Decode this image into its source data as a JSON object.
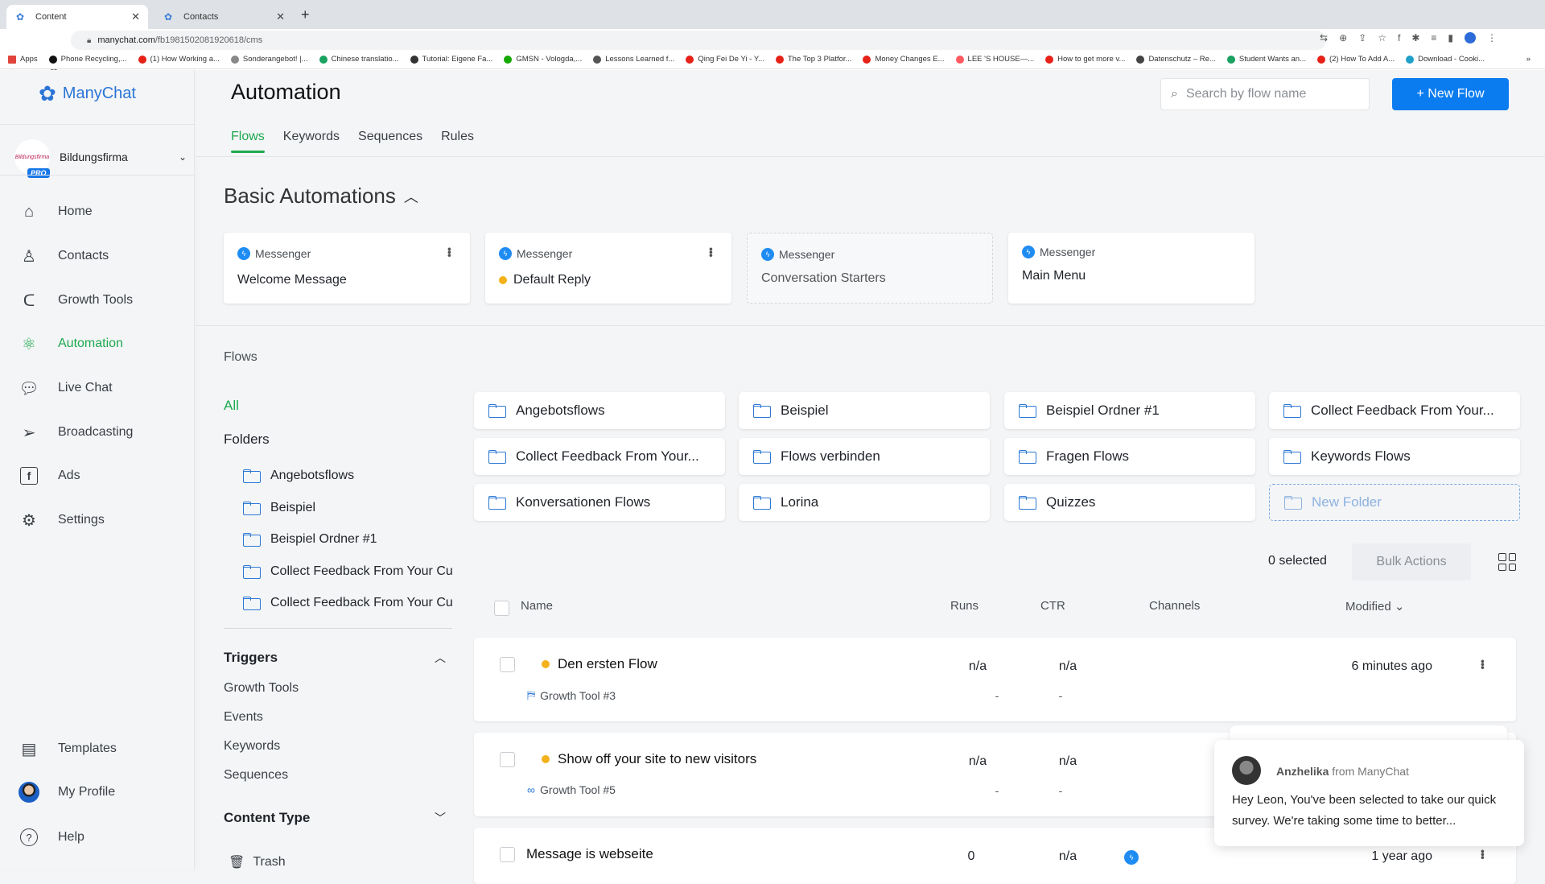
{
  "browser": {
    "tabs": [
      {
        "label": "Content",
        "active": true
      },
      {
        "label": "Contacts",
        "active": false
      }
    ],
    "new_tab": "+",
    "url_host": "manychat.com",
    "url_path": "/fb1981502081920618/cms",
    "bookmarks": [
      {
        "label": "Apps",
        "color": "#e0443a"
      },
      {
        "label": "Phone Recycling,...",
        "color": "#111111"
      },
      {
        "label": "(1) How Working a...",
        "color": "#e62117"
      },
      {
        "label": "Sonderangebot! |...",
        "color": "#888888"
      },
      {
        "label": "Chinese translatio...",
        "color": "#1aa260"
      },
      {
        "label": "Tutorial: Eigene Fa...",
        "color": "#333333"
      },
      {
        "label": "GMSN - Vologda,...",
        "color": "#14a800"
      },
      {
        "label": "Lessons Learned f...",
        "color": "#555555"
      },
      {
        "label": "Qing Fei De Yi - Y...",
        "color": "#e62117"
      },
      {
        "label": "The Top 3 Platfor...",
        "color": "#e62117"
      },
      {
        "label": "Money Changes E...",
        "color": "#e62117"
      },
      {
        "label": "LEE 'S HOUSE—...",
        "color": "#ff5a5f"
      },
      {
        "label": "How to get more v...",
        "color": "#e62117"
      },
      {
        "label": "Datenschutz – Re...",
        "color": "#444444"
      },
      {
        "label": "Student Wants an...",
        "color": "#1aa260"
      },
      {
        "label": "(2) How To Add A...",
        "color": "#e62117"
      },
      {
        "label": "Download - Cooki...",
        "color": "#1fa0c8"
      }
    ],
    "more": "»"
  },
  "sidebar": {
    "brand": "ManyChat",
    "account": {
      "name": "Bildungsfirma",
      "badge": "PRO",
      "logo_text": "Bildungsfirma"
    },
    "items": [
      {
        "label": "Home",
        "icon": "home-icon"
      },
      {
        "label": "Contacts",
        "icon": "user-icon"
      },
      {
        "label": "Growth Tools",
        "icon": "magnet-icon"
      },
      {
        "label": "Automation",
        "icon": "atom-icon",
        "active": true
      },
      {
        "label": "Live Chat",
        "icon": "chat-icon"
      },
      {
        "label": "Broadcasting",
        "icon": "send-icon"
      },
      {
        "label": "Ads",
        "icon": "facebook-icon"
      },
      {
        "label": "Settings",
        "icon": "gear-icon"
      }
    ],
    "bottom": [
      {
        "label": "Templates",
        "icon": "templates-icon"
      },
      {
        "label": "My Profile",
        "icon": "avatar"
      },
      {
        "label": "Help",
        "icon": "help-icon"
      }
    ]
  },
  "header": {
    "title": "Automation",
    "tabs": [
      "Flows",
      "Keywords",
      "Sequences",
      "Rules"
    ],
    "active_tab": "Flows",
    "search_placeholder": "Search by flow name",
    "new_flow": "+ New Flow"
  },
  "basic": {
    "title": "Basic Automations",
    "cards": [
      {
        "channel": "Messenger",
        "name": "Welcome Message",
        "status_dot": false,
        "dashed": false,
        "menu": true
      },
      {
        "channel": "Messenger",
        "name": "Default Reply",
        "status_dot": true,
        "dashed": false,
        "menu": true
      },
      {
        "channel": "Messenger",
        "name": "Conversation Starters",
        "status_dot": false,
        "dashed": true,
        "menu": false
      },
      {
        "channel": "Messenger",
        "name": "Main Menu",
        "status_dot": false,
        "dashed": false,
        "menu": false
      }
    ]
  },
  "flows_nav": {
    "label": "Flows",
    "all": "All",
    "folders_heading": "Folders",
    "folders": [
      "Angebotsflows",
      "Beispiel",
      "Beispiel Ordner #1",
      "Collect Feedback From Your Cu",
      "Collect Feedback From Your Cu"
    ],
    "triggers_heading": "Triggers",
    "triggers": [
      "Growth Tools",
      "Events",
      "Keywords",
      "Sequences"
    ],
    "content_type_heading": "Content Type",
    "trash": "Trash"
  },
  "folder_grid": [
    "Angebotsflows",
    "Beispiel",
    "Beispiel Ordner #1",
    "Collect Feedback From Your...",
    "Collect Feedback From Your...",
    "Flows verbinden",
    "Fragen Flows",
    "Keywords Flows",
    "Konversationen Flows",
    "Lorina",
    "Quizzes"
  ],
  "new_folder": "New Folder",
  "table": {
    "selected": "0 selected",
    "bulk_actions": "Bulk Actions",
    "columns": {
      "name": "Name",
      "runs": "Runs",
      "ctr": "CTR",
      "channels": "Channels",
      "modified": "Modified"
    },
    "rows": [
      {
        "name": "Den ersten Flow",
        "dot": true,
        "trigger": "Growth Tool #3",
        "runs": "n/a",
        "ctr": "n/a",
        "runs_sub": "-",
        "ctr_sub": "-",
        "channel": "",
        "modified": "6 minutes ago"
      },
      {
        "name": "Show off your site to new visitors",
        "dot": true,
        "trigger": "Growth Tool #5",
        "runs": "n/a",
        "ctr": "n/a",
        "runs_sub": "-",
        "ctr_sub": "-",
        "channel": "",
        "modified": ""
      },
      {
        "name": "Message is webseite",
        "dot": false,
        "trigger": "",
        "runs": "0",
        "ctr": "n/a",
        "runs_sub": "",
        "ctr_sub": "",
        "channel": "Messenger",
        "modified": "1 year ago"
      }
    ]
  },
  "chat_popup": {
    "sender": "Anzhelika",
    "from": "from ManyChat",
    "message": "Hey Leon,  You've been selected to take our quick survey. We're taking some time to better..."
  },
  "colors": {
    "accent_green": "#1ea94e",
    "primary_blue": "#0a7cf0",
    "status_yellow": "#f3b21b"
  }
}
